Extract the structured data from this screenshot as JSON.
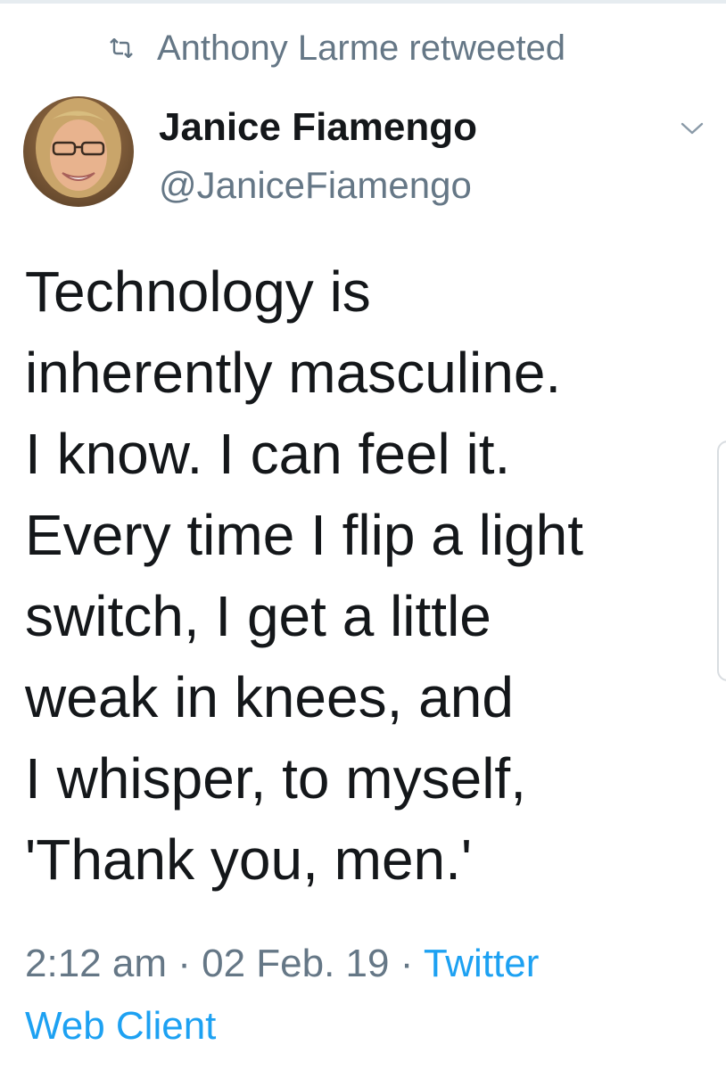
{
  "retweet": {
    "icon": "retweet-icon",
    "text": "Anthony Larme retweeted"
  },
  "author": {
    "avatar_icon": "avatar",
    "name": "Janice Fiamengo",
    "handle": "@JaniceFiamengo"
  },
  "menu": {
    "icon": "chevron-down-icon"
  },
  "tweet": {
    "lines": [
      "Technology is",
      "inherently masculine.",
      "I know. I can feel it.",
      "Every time I flip a light",
      "switch, I get a little",
      "weak in knees, and",
      "I whisper, to myself,",
      "'Thank you, men.'"
    ]
  },
  "meta": {
    "time": "2:12 am",
    "separator": "·",
    "date": "02 Feb. 19",
    "source_line1": "Twitter",
    "source_line2": "Web Client"
  },
  "colors": {
    "text": "#14171a",
    "muted": "#657786",
    "link": "#1da1f2",
    "border": "#e6ecf0"
  }
}
